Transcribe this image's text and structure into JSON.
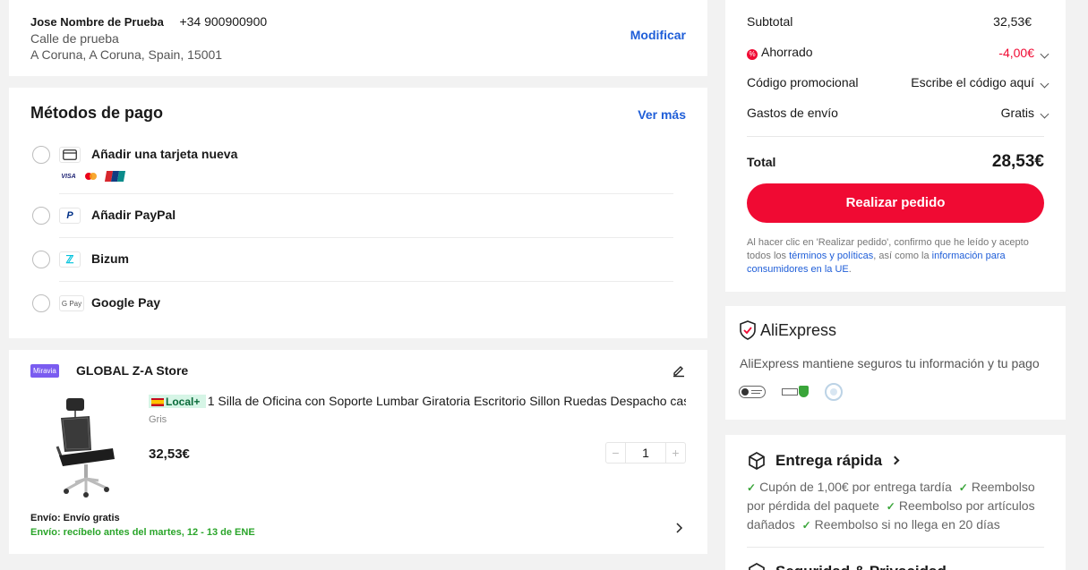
{
  "address": {
    "name": "Jose Nombre de Prueba",
    "phone": "+34 900900900",
    "street": "Calle de prueba",
    "city": "A Coruna, A Coruna, Spain, 15001",
    "edit_label": "Modificar"
  },
  "payment": {
    "title": "Métodos de pago",
    "see_more": "Ver más",
    "methods": [
      {
        "label": "Añadir una tarjeta nueva",
        "icon": "credit-card-icon"
      },
      {
        "label": "Añadir PayPal",
        "icon": "paypal-icon"
      },
      {
        "label": "Bizum",
        "icon": "bizum-icon"
      },
      {
        "label": "Google Pay",
        "icon": "google-pay-icon"
      }
    ],
    "card_brands": [
      "VISA",
      "mastercard",
      "UnionPay"
    ],
    "gpay_text": "G Pay"
  },
  "store": {
    "badge": "Miravia",
    "name": "GLOBAL Z-A Store",
    "product": {
      "local_tag": "Local+",
      "title": "1 Silla de Oficina con Soporte Lumbar Giratoria Escritorio Sillon Ruedas Despacho cas",
      "variant": "Gris",
      "price": "32,53€",
      "quantity": "1",
      "minus": "−",
      "plus": "+"
    },
    "shipping_label": "Envío: Envío gratis",
    "delivery_label": "Envío: recíbelo antes del martes, 12 - 13 de ENE"
  },
  "summary": {
    "subtotal_label": "Subtotal",
    "subtotal_value": "32,53€",
    "saved_label": "Ahorrado",
    "saved_value": "-4,00€",
    "promo_label": "Código promocional",
    "promo_value": "Escribe el código aquí",
    "shipping_label": "Gastos de envío",
    "shipping_value": "Gratis",
    "total_label": "Total",
    "total_value": "28,53€",
    "order_button": "Realizar pedido",
    "legal_1": "Al hacer clic en 'Realizar pedido', confirmo que he leído y acepto todos los ",
    "legal_link_1": "términos y políticas",
    "legal_2": ", así como la ",
    "legal_link_2": "información para consumidores en la UE",
    "legal_3": "."
  },
  "trust": {
    "brand": "AliExpress",
    "text": "AliExpress mantiene seguros tu información y tu pago"
  },
  "fast_delivery": {
    "title": "Entrega rápida",
    "item_1": "Cupón de 1,00€ por entrega tardía",
    "item_2": "Reembolso por pérdida del paquete",
    "item_3": "Reembolso por artículos dañados",
    "item_4": "Reembolso si no llega en 20 días",
    "next_title": "Seguridad & Privacidad"
  },
  "colors": {
    "accent_red": "#f00a33",
    "link_blue": "#1f5ed8",
    "green": "#2aa52a",
    "miravia_purple": "#7a5cf0"
  }
}
